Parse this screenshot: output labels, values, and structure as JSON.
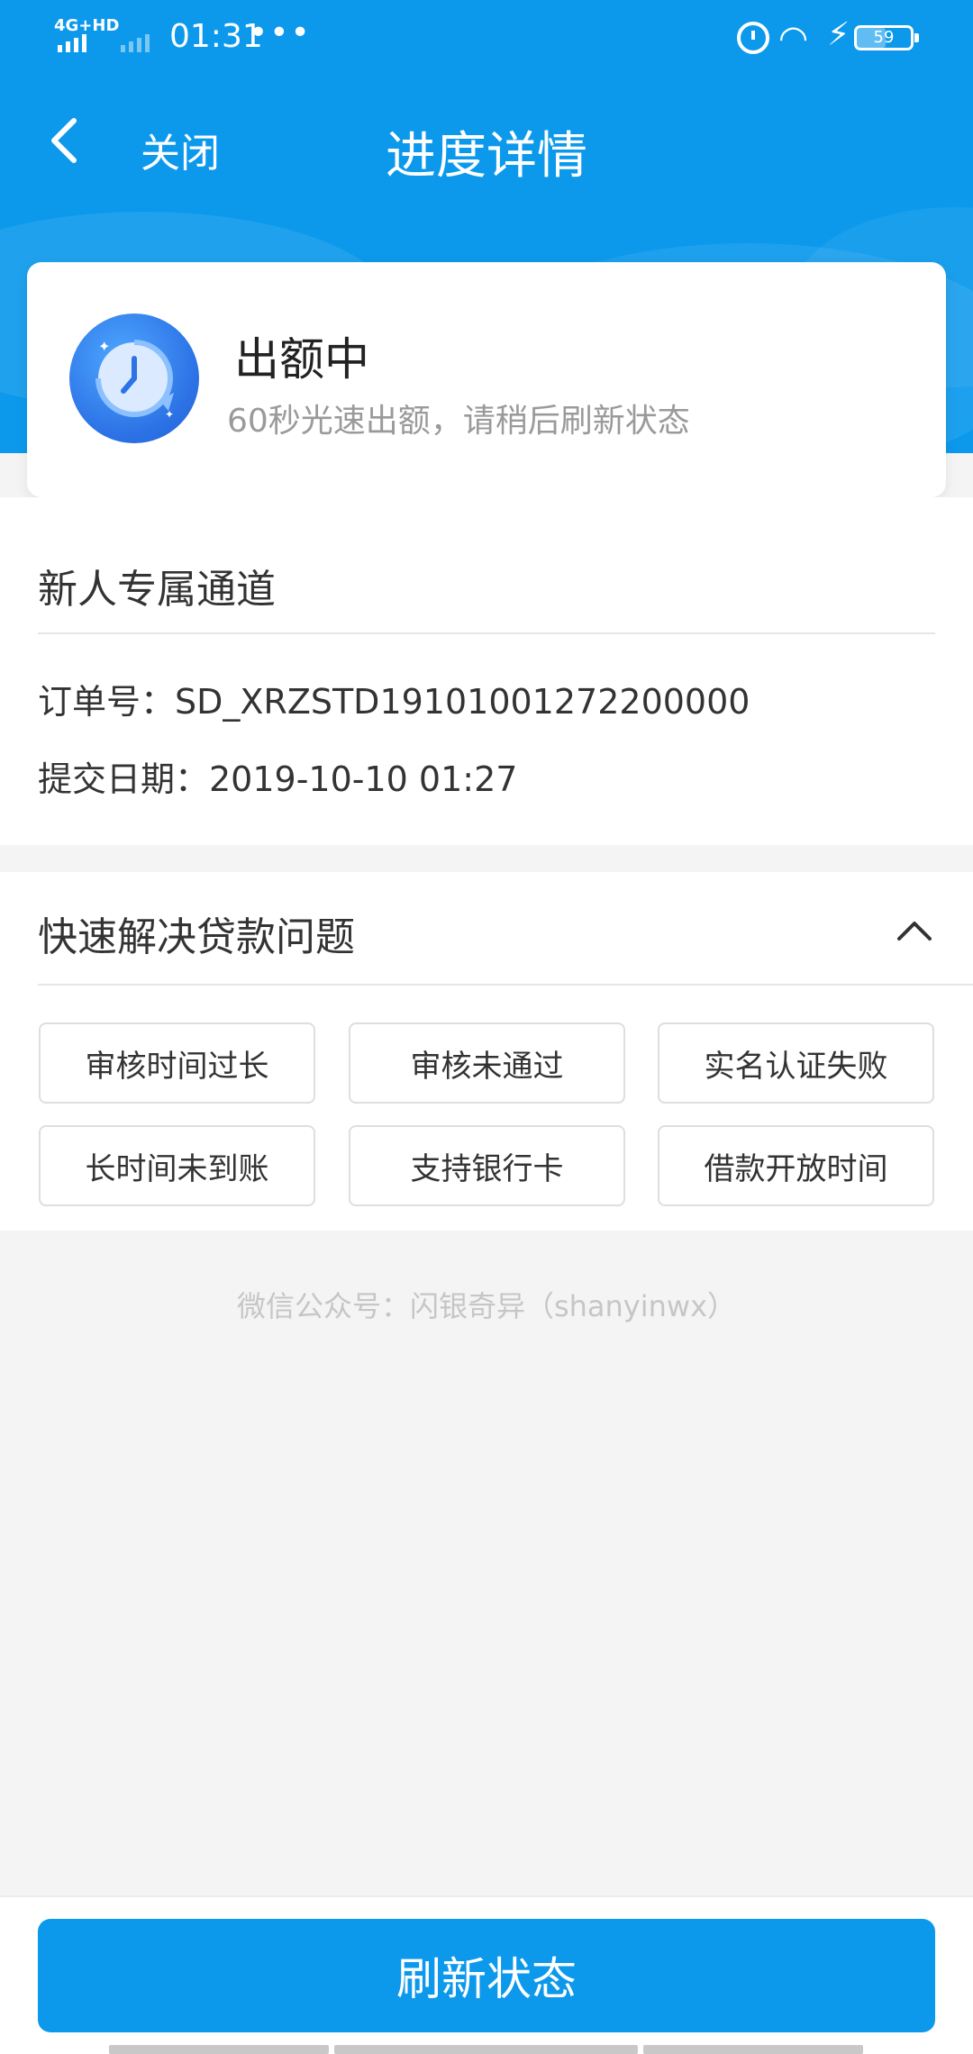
{
  "status_bar": {
    "network": "4G+HD",
    "time": "01:31",
    "more": "•••",
    "battery": "59"
  },
  "nav": {
    "close_label": "关闭",
    "title": "进度详情"
  },
  "status": {
    "title": "出额中",
    "subtitle": "60秒光速出额，请稍后刷新状态"
  },
  "order": {
    "channel": "新人专属通道",
    "order_no": "订单号：SD_XRZSTD19101001272200000",
    "submit_date": "提交日期：2019-10-10 01:27"
  },
  "faq": {
    "title": "快速解决贷款问题",
    "tags": [
      "审核时间过长",
      "审核未通过",
      "实名认证失败",
      "长时间未到账",
      "支持银行卡",
      "借款开放时间"
    ]
  },
  "watermark": "微信公众号：闪银奇异（shanyinwx）",
  "refresh_label": "刷新状态",
  "colors": {
    "primary": "#0c99ec",
    "background": "#f4f4f4"
  }
}
